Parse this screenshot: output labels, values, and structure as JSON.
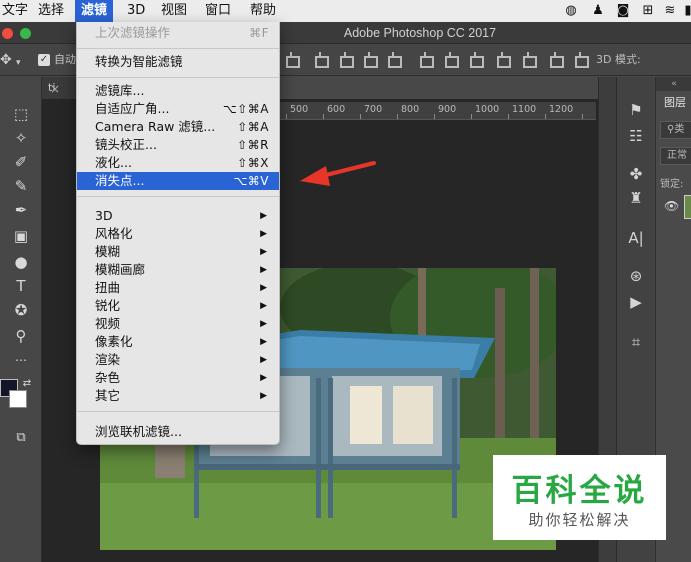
{
  "menubar": {
    "items": [
      "文字",
      "选择",
      "滤镜",
      "3D",
      "视图",
      "窗口",
      "帮助"
    ],
    "active": "滤镜"
  },
  "window": {
    "title": "Adobe Photoshop CC 2017"
  },
  "options_bar": {
    "auto_label": "自动",
    "mode_3d_label": "3D 模式:"
  },
  "document_tab": {
    "name": "ti"
  },
  "ruler": {
    "ticks": [
      "500",
      "600",
      "700",
      "800",
      "900",
      "1000",
      "1100",
      "1200"
    ]
  },
  "filter_menu": {
    "last_filter": {
      "label": "上次滤镜操作",
      "shortcut": "⌘F"
    },
    "convert_smart": "转换为智能滤镜",
    "group1": [
      {
        "label": "滤镜库...",
        "shortcut": ""
      },
      {
        "label": "自适应广角...",
        "shortcut": "⌥⇧⌘A"
      },
      {
        "label": "Camera Raw 滤镜...",
        "shortcut": "⇧⌘A"
      },
      {
        "label": "镜头校正...",
        "shortcut": "⇧⌘R"
      },
      {
        "label": "液化...",
        "shortcut": "⇧⌘X"
      },
      {
        "label": "消失点...",
        "shortcut": "⌥⌘V"
      }
    ],
    "highlighted": "消失点...",
    "submenus": [
      "3D",
      "风格化",
      "模糊",
      "模糊画廊",
      "扭曲",
      "锐化",
      "视频",
      "像素化",
      "渲染",
      "杂色",
      "其它"
    ],
    "browse_online": "浏览联机滤镜..."
  },
  "layers_panel": {
    "title": "图层",
    "search_placeholder": "类",
    "blend_mode": "正常",
    "lock_label": "锁定:"
  },
  "watermark": {
    "title": "百科全说",
    "subtitle": "助你轻松解决"
  },
  "colors": {
    "menu_highlight": "#2a63d4",
    "annotation_arrow": "#e8352a",
    "watermark_green": "#27a843"
  }
}
